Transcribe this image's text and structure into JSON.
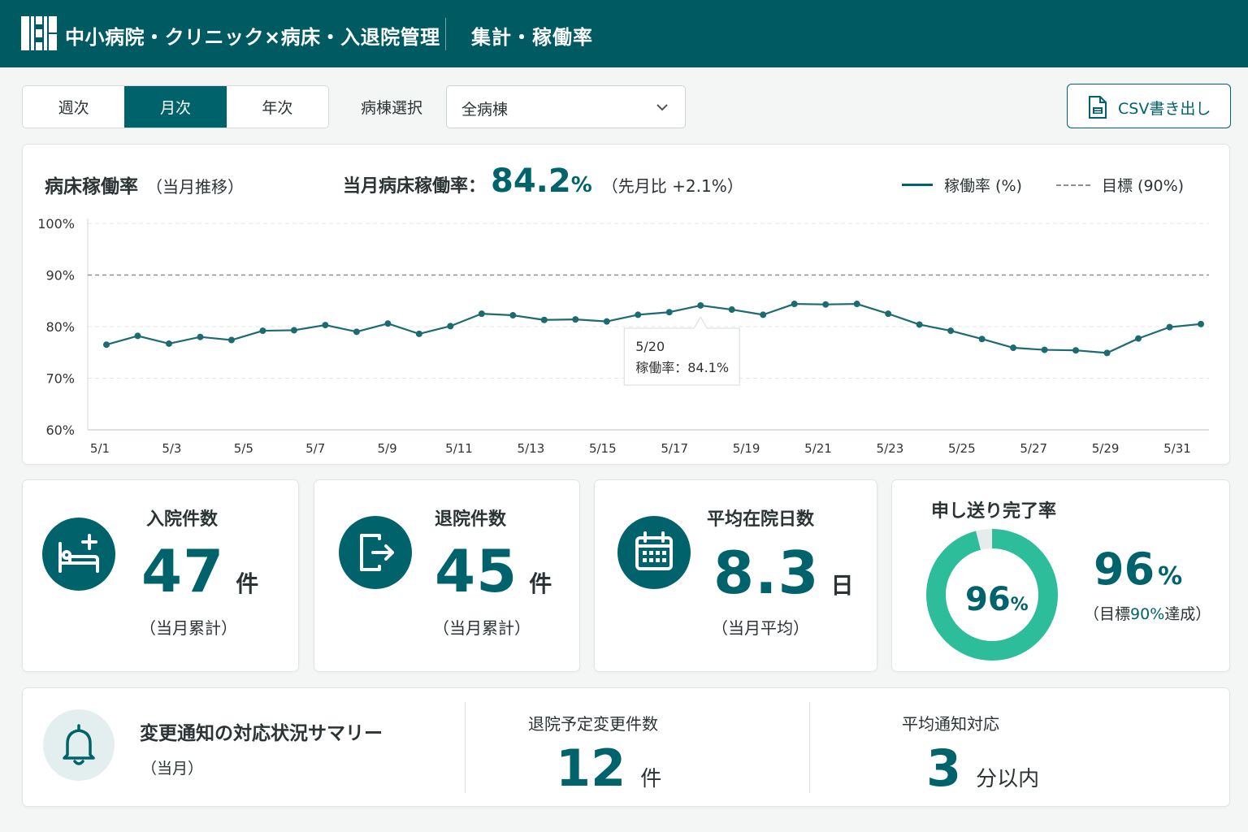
{
  "header": {
    "app_title": "中小病院・クリニック×病床・入退院管理",
    "page_title": "集計・稼働率"
  },
  "toolbar": {
    "period_tabs": [
      {
        "label": "週次",
        "active": false
      },
      {
        "label": "月次",
        "active": true
      },
      {
        "label": "年次",
        "active": false
      }
    ],
    "ward_label": "病棟選択",
    "ward_value": "全病棟",
    "csv_label": "CSV書き出し"
  },
  "occupancy": {
    "title": "病床稼働率",
    "subtitle": "（当月推移）",
    "current_label": "当月病床稼働率：",
    "current_value": "84.2",
    "current_unit": "%",
    "delta": "（先月比 +2.1%）",
    "legend_rate": "稼働率 (%)",
    "legend_target": "目標 (90%)",
    "tooltip_date": "5/20",
    "tooltip_text": "稼働率：84.1%"
  },
  "chart_data": {
    "type": "line",
    "x": [
      "5/1",
      "5/2",
      "5/3",
      "5/4",
      "5/5",
      "5/6",
      "5/7",
      "5/8",
      "5/9",
      "5/10",
      "5/11",
      "5/12",
      "5/13",
      "5/14",
      "5/15",
      "5/16",
      "5/17",
      "5/18",
      "5/19",
      "5/20",
      "5/21",
      "5/22",
      "5/23",
      "5/24",
      "5/25",
      "5/26",
      "5/27",
      "5/28",
      "5/29",
      "5/30",
      "5/31"
    ],
    "x_tick_labels": [
      "5/1",
      "5/3",
      "5/5",
      "5/7",
      "5/9",
      "5/11",
      "5/13",
      "5/15",
      "5/17",
      "5/19",
      "5/21",
      "5/23",
      "5/25",
      "5/27",
      "5/29",
      "5/31"
    ],
    "series": [
      {
        "name": "稼働率 (%)",
        "values": [
          76.5,
          78.2,
          76.7,
          78.0,
          77.4,
          79.2,
          79.3,
          80.3,
          79.0,
          80.6,
          78.6,
          80.1,
          82.5,
          82.2,
          81.3,
          81.4,
          81.0,
          82.3,
          82.8,
          84.1,
          83.3,
          82.3,
          84.4,
          84.3,
          84.4,
          82.5,
          80.4,
          79.2,
          77.6,
          75.9,
          75.5,
          75.4,
          74.9,
          77.7,
          79.9,
          80.5
        ]
      },
      {
        "name": "目標 (90%)",
        "values": [
          90
        ]
      }
    ],
    "ylim": [
      60,
      100
    ],
    "y_ticks": [
      "100%",
      "90%",
      "80%",
      "70%",
      "60%"
    ],
    "grid": true,
    "legend": "top-right",
    "color_rate": "#1c6b70",
    "color_target": "#8a9193"
  },
  "kpis": {
    "admissions": {
      "title": "入院件数",
      "value": "47",
      "unit": "件",
      "note": "（当月累計）"
    },
    "discharges": {
      "title": "退院件数",
      "value": "45",
      "unit": "件",
      "note": "（当月累計）"
    },
    "avg_stay": {
      "title": "平均在院日数",
      "value": "8.3",
      "unit": "日",
      "note": "（当月平均）"
    },
    "handover": {
      "title": "申し送り完了率",
      "percent": 96,
      "donut_value": "96",
      "donut_unit": "%",
      "value": "96",
      "unit": "%",
      "note_prefix": "（目標",
      "note_target": "90%",
      "note_suffix": "達成）"
    }
  },
  "summary": {
    "title": "変更通知の対応状況サマリー",
    "subtitle": "（当月）",
    "discharge_change_label": "退院予定変更件数",
    "discharge_change_value": "12",
    "discharge_change_unit": "件",
    "avg_response_label": "平均通知対応",
    "avg_response_value": "3",
    "avg_response_unit": "分以内"
  },
  "colors": {
    "brand": "#005a62",
    "accent": "#00636b",
    "donut": "#2ebd9a",
    "donut_track": "#e6ecec"
  },
  "icons": [
    "hospital-logo-icon",
    "chevron-down-icon",
    "csv-file-icon",
    "bed-plus-icon",
    "exit-icon",
    "calendar-icon",
    "bell-icon"
  ]
}
